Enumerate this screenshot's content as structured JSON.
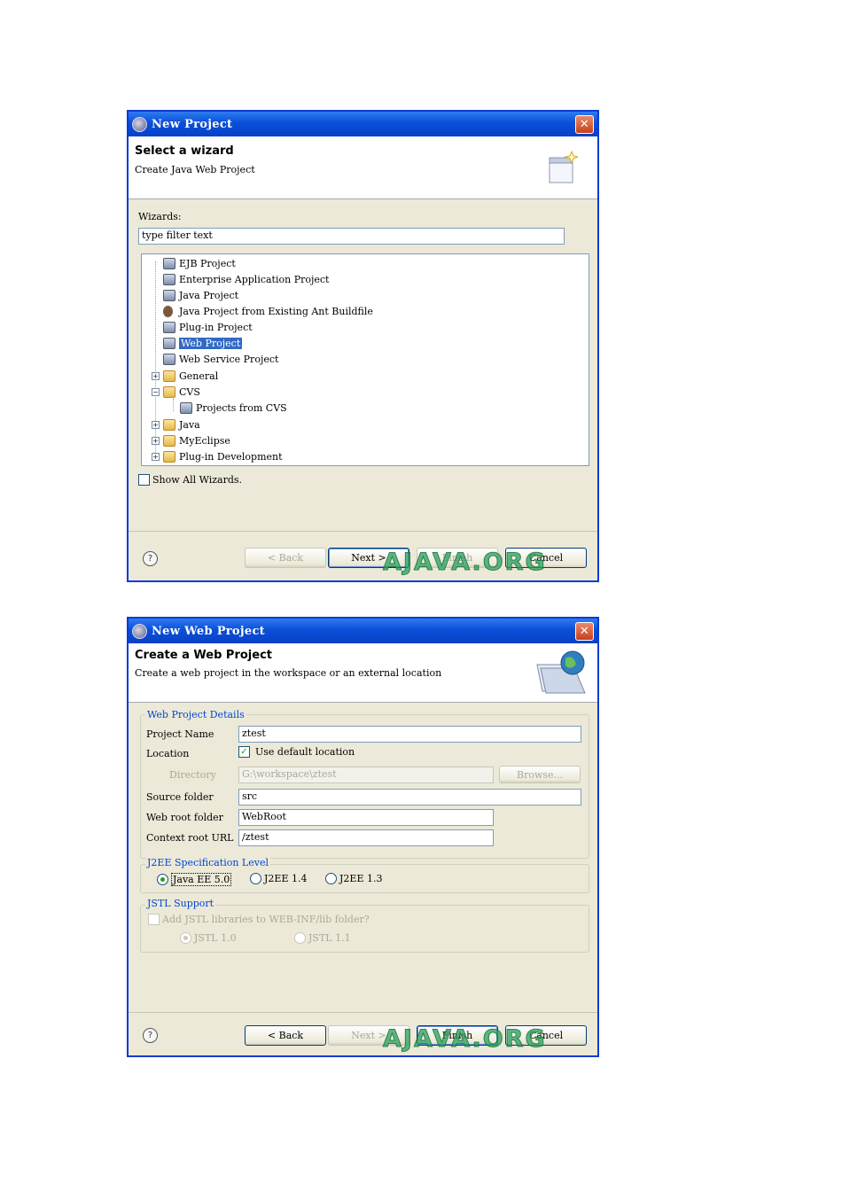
{
  "dialog1": {
    "title": "New Project",
    "header_title": "Select a wizard",
    "header_subtitle": "Create Java Web Project",
    "wizards_label": "Wizards:",
    "filter_value": "type filter text",
    "tree": [
      {
        "label": "EJB Project"
      },
      {
        "label": "Enterprise Application Project"
      },
      {
        "label": "Java Project"
      },
      {
        "label": "Java Project from Existing Ant Buildfile"
      },
      {
        "label": "Plug-in Project"
      },
      {
        "label": "Web Project",
        "selected": true
      },
      {
        "label": "Web Service Project"
      },
      {
        "label": "General",
        "expander": "+"
      },
      {
        "label": "CVS",
        "expander": "−"
      },
      {
        "label": "Projects from CVS"
      },
      {
        "label": "Java",
        "expander": "+"
      },
      {
        "label": "MyEclipse",
        "expander": "+"
      },
      {
        "label": "Plug-in Development",
        "expander": "+"
      }
    ],
    "show_all_label": "Show All Wizards.",
    "show_all_checked": false,
    "buttons": {
      "back": "< Back",
      "next": "Next >",
      "finish": "Finish",
      "cancel": "Cancel"
    }
  },
  "dialog2": {
    "title": "New Web Project",
    "header_title": "Create a Web Project",
    "header_subtitle": "Create a web project in the workspace or an external location",
    "details_group": "Web Project Details",
    "project_name_label": "Project Name",
    "project_name_value": "ztest",
    "location_label": "Location",
    "use_default_label": "Use default location",
    "use_default_checked": true,
    "directory_label": "Directory",
    "directory_value": "G:\\workspace\\ztest",
    "browse_label": "Browse...",
    "source_folder_label": "Source folder",
    "source_folder_value": "src",
    "web_root_label": "Web root folder",
    "web_root_value": "WebRoot",
    "context_root_label": "Context root URL",
    "context_root_value": "/ztest",
    "j2ee_group": "J2EE Specification Level",
    "j2ee_options": [
      "Java EE 5.0",
      "J2EE 1.4",
      "J2EE 1.3"
    ],
    "j2ee_selected": "Java EE 5.0",
    "jstl_group": "JSTL Support",
    "jstl_checkbox_label": "Add JSTL libraries to WEB-INF/lib folder?",
    "jstl_options": [
      "JSTL 1.0",
      "JSTL 1.1"
    ],
    "buttons": {
      "back": "< Back",
      "next": "Next >",
      "finish": "Finish",
      "cancel": "Cancel"
    }
  },
  "watermark": "AJAVA.ORG",
  "help_glyph": "?",
  "close_glyph": "✕",
  "check_glyph": "✓",
  "colors": {
    "titlebar": "#0a4fd8",
    "selection": "#316ac5",
    "group_label": "#0046d5",
    "watermark": "#28a05a"
  }
}
